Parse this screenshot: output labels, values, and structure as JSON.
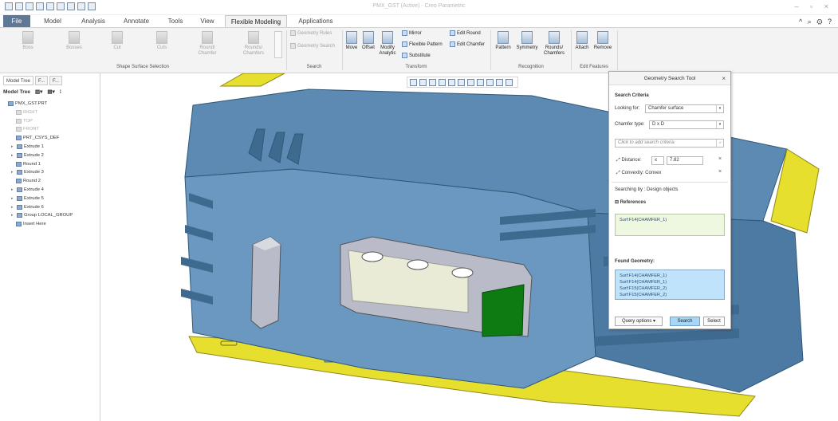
{
  "window": {
    "title": "PMX_GST (Active) - Creo Parametric",
    "controls": "– ▫ ×"
  },
  "tabs": [
    "File",
    "Model",
    "Analysis",
    "Annotate",
    "Tools",
    "View",
    "Flexible Modeling",
    "Applications"
  ],
  "active_tab": "Flexible Modeling",
  "top_right_icons": "^ ⌕ ⚙ ?",
  "ribbon": {
    "shape_selection": {
      "buttons": [
        "Boss",
        "Bosses",
        "Cut",
        "Cuts",
        "Round/ Chamfer",
        "Rounds/ Chamfers"
      ],
      "group_label": "Shape Surface Selection"
    },
    "search": {
      "geometry_rules": "Geometry Rules",
      "geometry_search": "Geometry Search",
      "group_label": "Search"
    },
    "transform": {
      "move": "Move",
      "offset": "Offset",
      "modify_analytic": "Modify Analytic",
      "mirror": "Mirror",
      "flexible_pattern": "Flexible Pattern",
      "substitute": "Substitute",
      "edit_round": "Edit Round",
      "edit_chamfer": "Edit Chamfer",
      "group_label": "Transform"
    },
    "recognition": {
      "pattern": "Pattern",
      "symmetry": "Symmetry",
      "rounds_chamfers": "Rounds/ Chamfers",
      "group_label": "Recognition"
    },
    "edit_features": {
      "attach": "Attach",
      "remove": "Remove",
      "group_label": "Edit Features"
    }
  },
  "left_panel": {
    "tabs": [
      "Model Tree",
      "F...",
      "F..."
    ],
    "tree_header": "Model Tree",
    "items": [
      {
        "label": "PMX_GST.PRT",
        "dim": false
      },
      {
        "label": "RIGHT",
        "dim": true
      },
      {
        "label": "TOP",
        "dim": true
      },
      {
        "label": "FRONT",
        "dim": true
      },
      {
        "label": "PRT_CSYS_DEF",
        "dim": false
      },
      {
        "label": "Extrude 1",
        "dim": false
      },
      {
        "label": "Extrude 2",
        "dim": false
      },
      {
        "label": "Round 1",
        "dim": false
      },
      {
        "label": "Extrude 3",
        "dim": false
      },
      {
        "label": "Round 2",
        "dim": false
      },
      {
        "label": "Extrude 4",
        "dim": false
      },
      {
        "label": "Extrude 5",
        "dim": false
      },
      {
        "label": "Extrude 6",
        "dim": false
      },
      {
        "label": "Group LOCAL_GROUP",
        "dim": false
      },
      {
        "label": "Insert Here",
        "dim": false
      }
    ]
  },
  "dialog": {
    "title": "Geometry Search Tool",
    "search_criteria": "Search Criteria",
    "looking_for_label": "Looking for:",
    "looking_for_value": "Chamfer surface",
    "chamfer_type_label": "Chamfer type:",
    "chamfer_type_value": "D x D",
    "add_criteria_placeholder": "Click to add search criteria",
    "distance_label": "Distance:",
    "distance_op": "≤",
    "distance_value": "7.82",
    "convexity_label": "Convexity: Convex",
    "searching_by": "Searching by : Design objects",
    "references_label": "References",
    "references": [
      "Surf:F14(CHAMFER_1)"
    ],
    "found_label": "Found Geometry:",
    "found": [
      "Surf:F14(CHAMFER_1)",
      "Surf:F14(CHAMFER_1)",
      "Surf:F15(CHAMFER_2)",
      "Surf:F15(CHAMFER_2)"
    ],
    "query_options": "Query options",
    "search_button": "Search",
    "select_button": "Select"
  },
  "colors": {
    "part_body": "#5d8ab2",
    "part_dark": "#3f6a90",
    "highlight_yellow": "#e6df2e",
    "selected_green": "#0e7a12",
    "file_tab": "#5e7896",
    "found_list": "#bfe3fb",
    "references_box": "#eef7df"
  }
}
